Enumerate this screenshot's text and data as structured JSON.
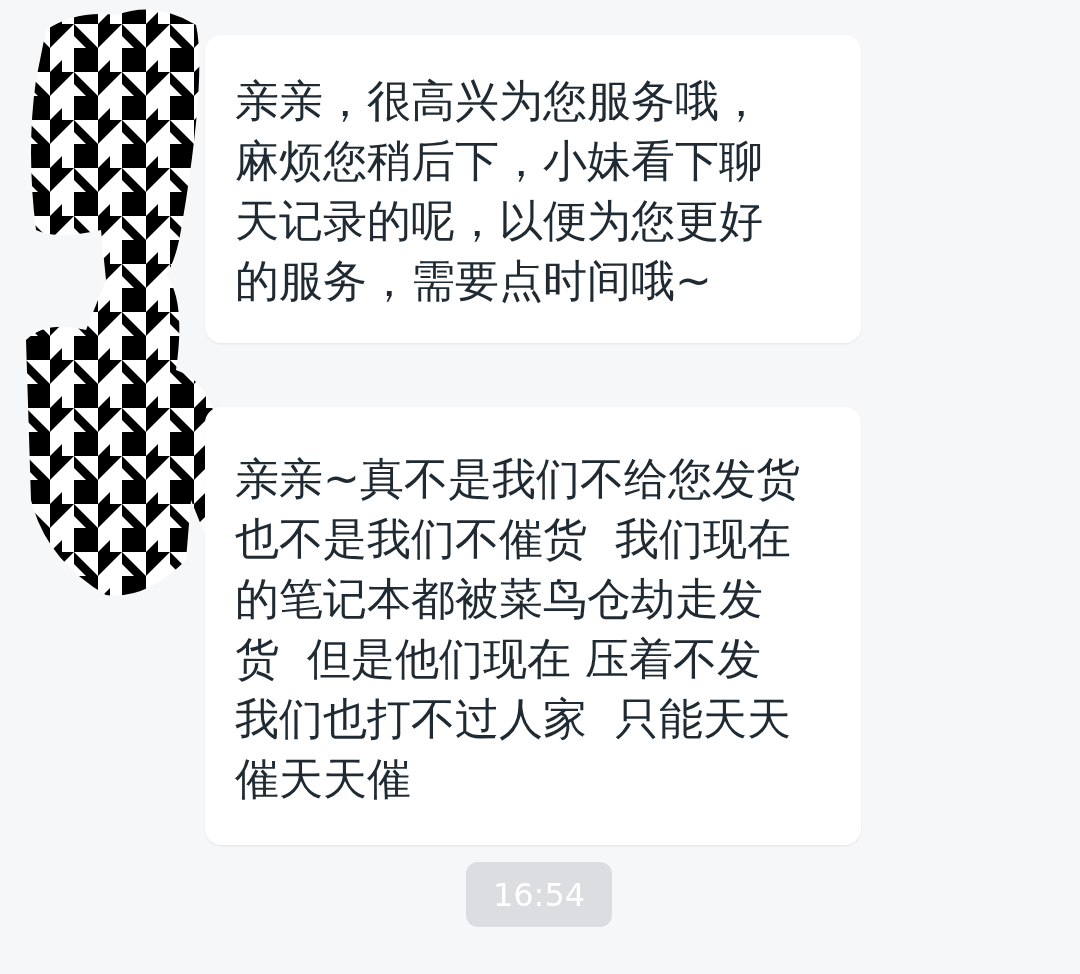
{
  "messages": [
    {
      "kind": "incoming",
      "text": "亲亲，很高兴为您服务哦，麻烦您稍后下，小妹看下聊天记录的呢，以便为您更好的服务，需要点时间哦~"
    },
    {
      "kind": "incoming",
      "text": "亲亲~真不是我们不给您发货也不是我们不催货  我们现在的笔记本都被菜鸟仓劫走发货  但是他们现在 压着不发我们也打不过人家  只能天天催天天催"
    }
  ],
  "timestamp": "16:54"
}
